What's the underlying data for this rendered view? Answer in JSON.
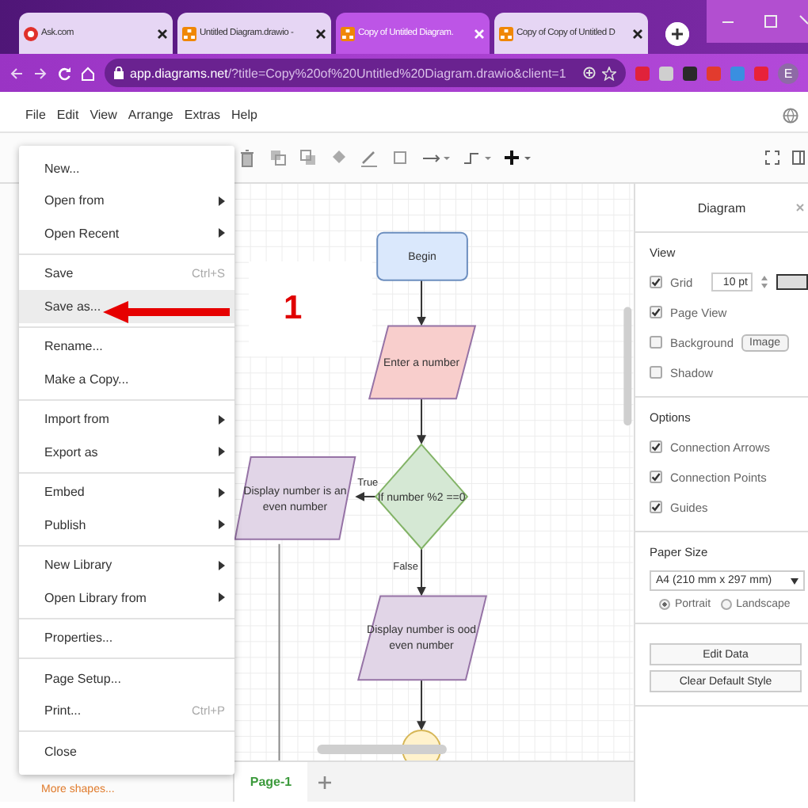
{
  "browser": {
    "tabs": [
      {
        "kind": "ask",
        "title": "Ask.com",
        "selected": false
      },
      {
        "kind": "drawio",
        "title": "Untitled Diagram.drawio - ",
        "selected": false
      },
      {
        "kind": "drawio",
        "title": "Copy of Untitled Diagram.",
        "selected": true
      },
      {
        "kind": "drawio",
        "title": "Copy of Copy of Untitled D",
        "selected": false
      }
    ],
    "address": {
      "host": "app.diagrams.net",
      "path": "/?title=Copy%20of%20Untitled%20Diagram.drawio&client=1"
    },
    "profile": "E"
  },
  "menubar": [
    "File",
    "Edit",
    "View",
    "Arrange",
    "Extras",
    "Help"
  ],
  "file_menu": [
    [
      {
        "label": "New...",
        "submenu": false,
        "selected": false
      },
      {
        "label": "Open from",
        "submenu": true,
        "selected": false
      },
      {
        "label": "Open Recent",
        "submenu": true,
        "selected": false
      }
    ],
    [
      {
        "label": "Save",
        "shortcut": "Ctrl+S",
        "submenu": false,
        "selected": false
      },
      {
        "label": "Save as...",
        "submenu": false,
        "selected": true
      }
    ],
    [
      {
        "label": "Rename...",
        "submenu": false,
        "selected": false
      },
      {
        "label": "Make a Copy...",
        "submenu": false,
        "selected": false
      }
    ],
    [
      {
        "label": "Import from",
        "submenu": true,
        "selected": false
      },
      {
        "label": "Export as",
        "submenu": true,
        "selected": false
      }
    ],
    [
      {
        "label": "Embed",
        "submenu": true,
        "selected": false
      },
      {
        "label": "Publish",
        "submenu": true,
        "selected": false
      }
    ],
    [
      {
        "label": "New Library",
        "submenu": true,
        "selected": false
      },
      {
        "label": "Open Library from",
        "submenu": true,
        "selected": false
      }
    ],
    [
      {
        "label": "Properties...",
        "submenu": false,
        "selected": false
      }
    ],
    [
      {
        "label": "Page Setup...",
        "submenu": false,
        "selected": false
      },
      {
        "label": "Print...",
        "shortcut": "Ctrl+P",
        "submenu": false,
        "selected": false
      }
    ],
    [
      {
        "label": "Close",
        "submenu": false,
        "selected": false
      }
    ]
  ],
  "annotation": {
    "label": "1"
  },
  "sidebar": {
    "more_shapes": "More shapes..."
  },
  "diagram": {
    "nodes": [
      {
        "kind": "terminator",
        "lines": [
          "Begin"
        ]
      },
      {
        "kind": "io",
        "lines": [
          "Enter a number"
        ],
        "color": "#f8cecc"
      },
      {
        "kind": "io",
        "lines": [
          "Display number is an",
          "even number"
        ],
        "color": "#e1d5e7"
      },
      {
        "kind": "decision",
        "lines": [
          "If number %2 ==0"
        ]
      },
      {
        "kind": "io",
        "lines": [
          "Display number is ood",
          "even number"
        ],
        "color": "#e1d5e7"
      },
      {
        "kind": "circle"
      }
    ],
    "edge_labels": [
      "True",
      "False"
    ]
  },
  "page_tabs": [
    {
      "label": "Page-1",
      "selected": true
    }
  ],
  "format_panel": {
    "title": "Diagram",
    "sections": [
      {
        "heading": "View",
        "rows": [
          {
            "kind": "checkbox",
            "label": "Grid",
            "checked": true,
            "field": "10 pt",
            "swatch": true
          },
          {
            "kind": "checkbox",
            "label": "Page View",
            "checked": true
          },
          {
            "kind": "checkbox",
            "label": "Background",
            "checked": false,
            "button": "Image"
          },
          {
            "kind": "checkbox",
            "label": "Shadow",
            "checked": false
          }
        ]
      },
      {
        "heading": "Options",
        "rows": [
          {
            "kind": "checkbox",
            "label": "Connection Arrows",
            "checked": true
          },
          {
            "kind": "checkbox",
            "label": "Connection Points",
            "checked": true
          },
          {
            "kind": "checkbox",
            "label": "Guides",
            "checked": true
          }
        ]
      },
      {
        "heading": "Paper Size",
        "rows": [
          {
            "kind": "select",
            "value": "A4 (210 mm x 297 mm)"
          },
          {
            "kind": "radios",
            "options": [
              {
                "label": "Portrait",
                "selected": true
              },
              {
                "label": "Landscape",
                "selected": false
              }
            ]
          }
        ]
      },
      {
        "rows": [
          {
            "kind": "button",
            "label": "Edit Data"
          },
          {
            "kind": "button",
            "label": "Clear Default Style"
          }
        ]
      }
    ]
  }
}
